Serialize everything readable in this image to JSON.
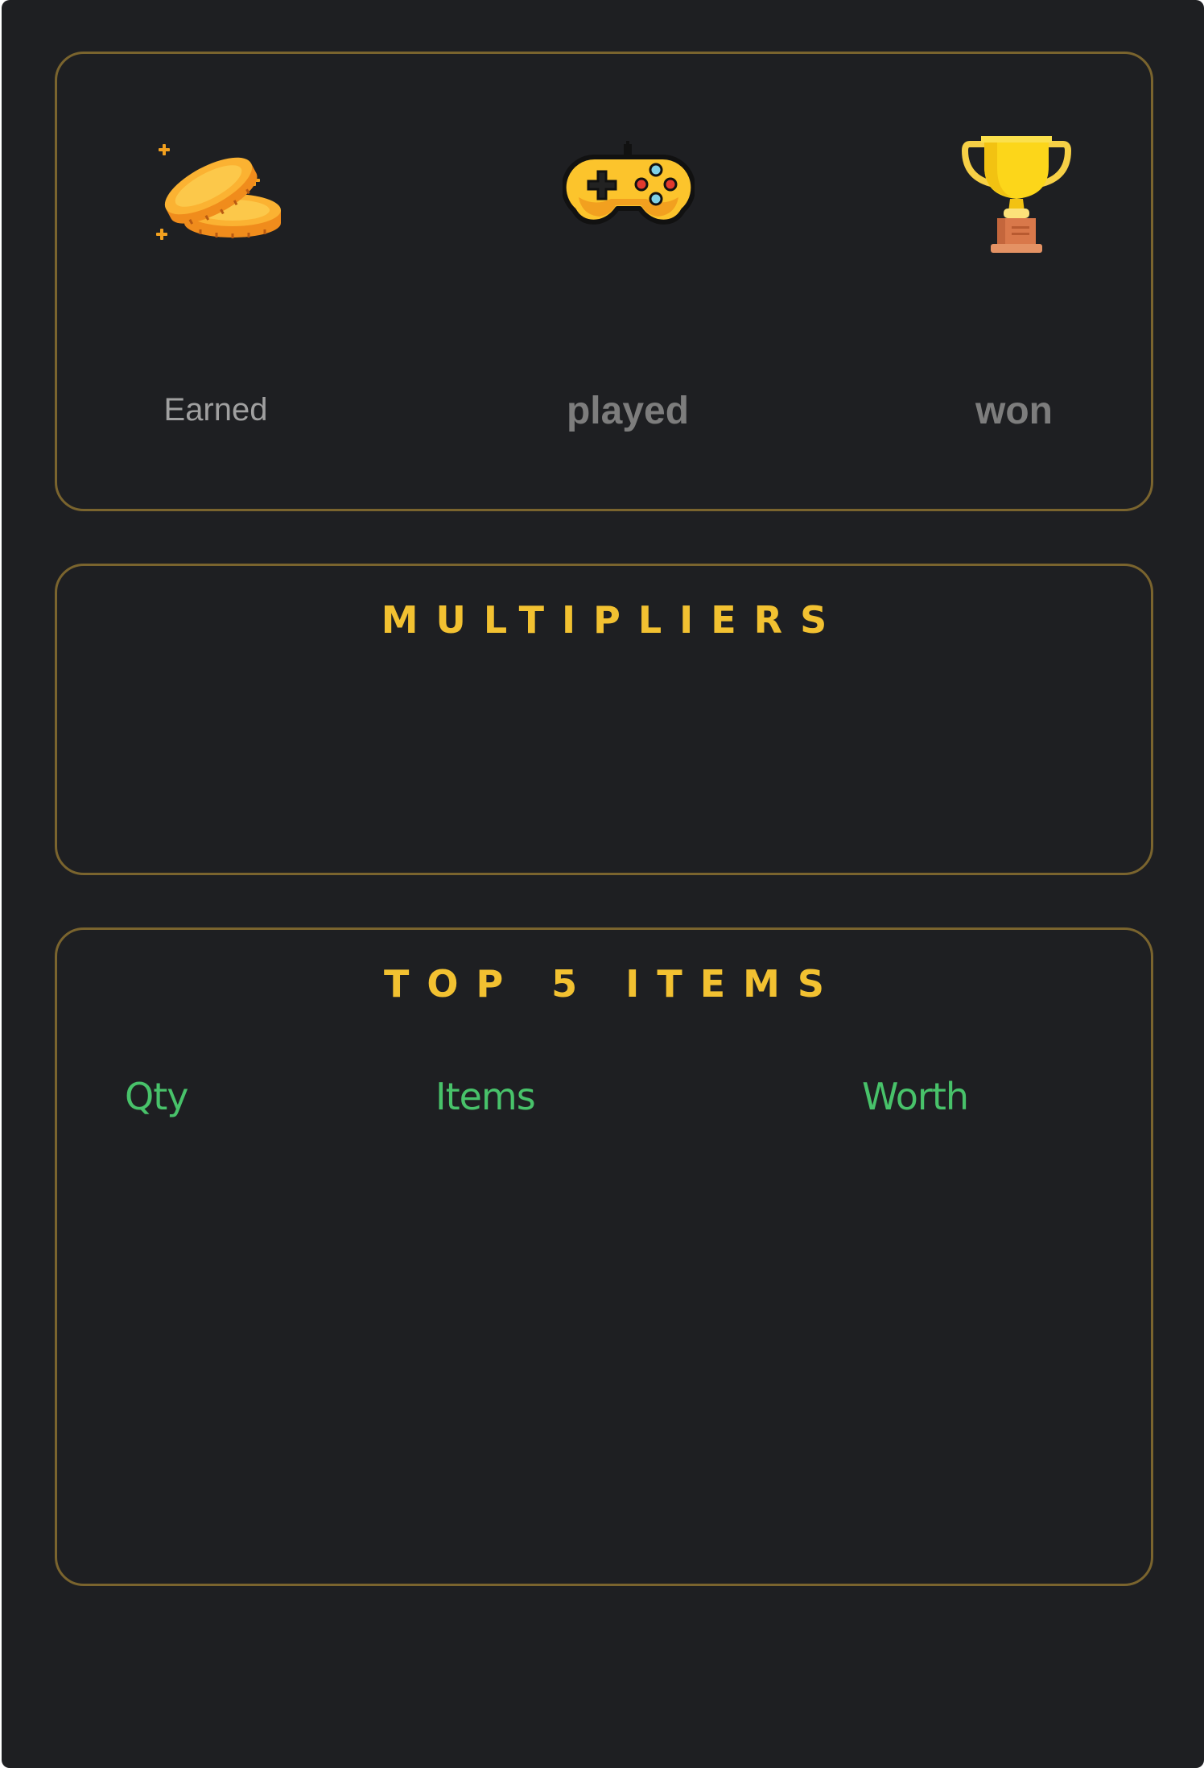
{
  "stats": {
    "earned": {
      "label": "Earned",
      "icon": "coins-icon"
    },
    "played": {
      "label": "played",
      "icon": "gamepad-icon"
    },
    "won": {
      "label": "won",
      "icon": "trophy-icon"
    }
  },
  "multipliers": {
    "title": "MULTIPLIERS"
  },
  "top_items": {
    "title": "TOP 5 ITEMS",
    "columns": [
      "Qty",
      "Items",
      "Worth"
    ]
  },
  "colors": {
    "background": "#1e1f22",
    "card_border": "#7a642e",
    "title_gold": "#f2c131",
    "header_green": "#48c26a",
    "label_gray": "#7d7d7d"
  }
}
